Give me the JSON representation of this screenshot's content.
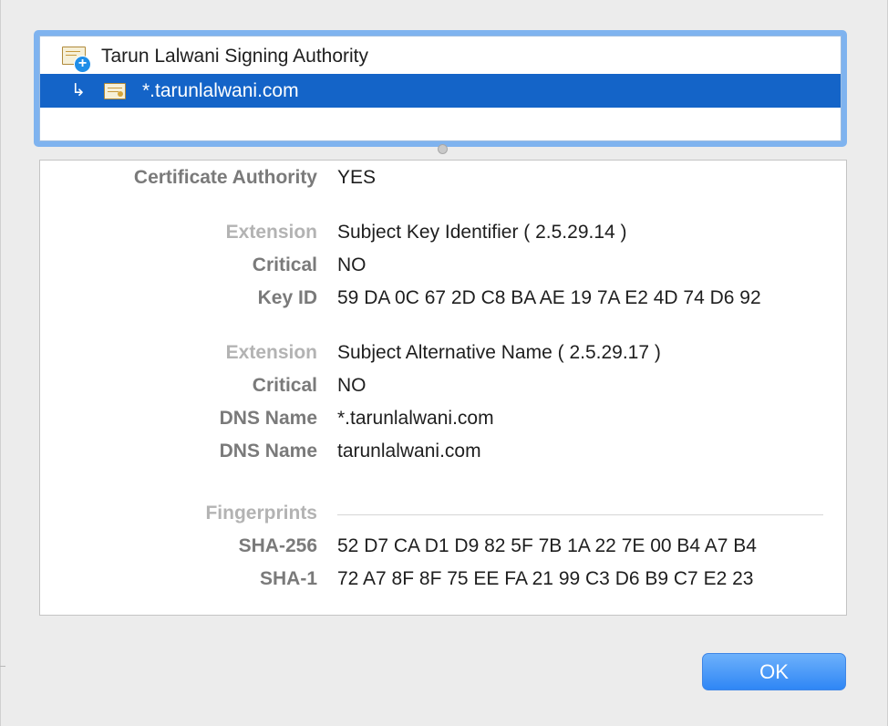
{
  "tree": {
    "items": [
      {
        "label": "Tarun Lalwani Signing Authority",
        "icon": "root-certificate-icon",
        "selected": false
      },
      {
        "label": "*.tarunlalwani.com",
        "icon": "certificate-icon",
        "selected": true
      }
    ]
  },
  "details": {
    "certificate_authority": {
      "key": "Certificate Authority",
      "value": "YES"
    },
    "extension1": {
      "extension_key": "Extension",
      "extension_value": "Subject Key Identifier ( 2.5.29.14 )",
      "critical_key": "Critical",
      "critical_value": "NO",
      "key_id_key": "Key ID",
      "key_id_value": "59 DA 0C 67 2D C8 BA AE 19 7A E2 4D 74 D6 92"
    },
    "extension2": {
      "extension_key": "Extension",
      "extension_value": "Subject Alternative Name ( 2.5.29.17 )",
      "critical_key": "Critical",
      "critical_value": "NO",
      "dns1_key": "DNS Name",
      "dns1_value": "*.tarunlalwani.com",
      "dns2_key": "DNS Name",
      "dns2_value": "tarunlalwani.com"
    },
    "fingerprints": {
      "heading": "Fingerprints",
      "sha256_key": "SHA-256",
      "sha256_value": "52 D7 CA D1 D9 82 5F 7B 1A 22 7E 00 B4 A7 B4",
      "sha1_key": "SHA-1",
      "sha1_value": "72 A7 8F 8F 75 EE FA 21 99 C3 D6 B9 C7 E2 23"
    }
  },
  "buttons": {
    "ok_label": "OK"
  },
  "colors": {
    "selection": "#1464c8",
    "accent": "#2f86f5",
    "focus_ring": "#7fb3ef"
  }
}
